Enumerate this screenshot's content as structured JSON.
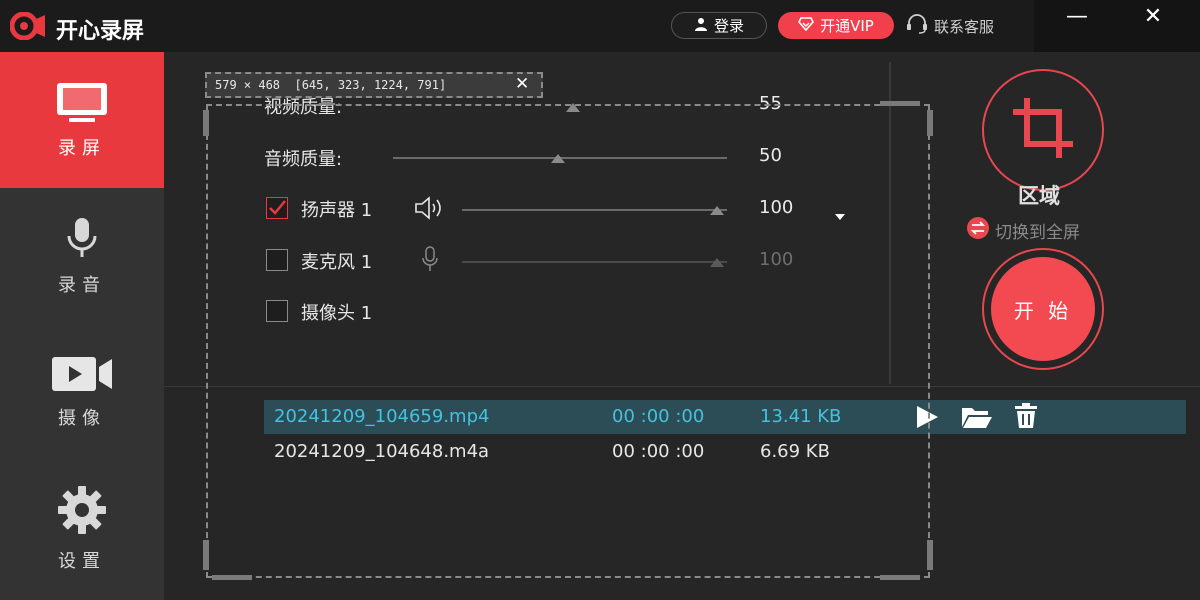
{
  "app": {
    "title": "开心录屏"
  },
  "header": {
    "login": "登录",
    "vip": "开通VIP",
    "service": "联系客服",
    "minimize": "—",
    "close": "✕"
  },
  "sidebar": {
    "items": [
      {
        "label": "录屏",
        "active": true
      },
      {
        "label": "录音",
        "active": false
      },
      {
        "label": "摄像",
        "active": false
      },
      {
        "label": "设置",
        "active": false
      }
    ]
  },
  "settings": {
    "video_quality": {
      "label": "视频质量:",
      "value": "55"
    },
    "audio_quality": {
      "label": "音频质量:",
      "value": "50"
    },
    "speaker": {
      "label": "扬声器 1",
      "value": "100",
      "checked": true
    },
    "mic": {
      "label": "麦克风 1",
      "value": "100",
      "checked": false
    },
    "camera": {
      "label": "摄像头 1",
      "checked": false
    }
  },
  "right_panel": {
    "region_label": "区域",
    "switch_label": "切换到全屏",
    "start_label": "开 始"
  },
  "files": [
    {
      "name": "20241209_104659.mp4",
      "duration": "00 :00 :00",
      "size": "13.41 KB",
      "selected": true
    },
    {
      "name": "20241209_104648.m4a",
      "duration": "00 :00 :00",
      "size": "6.69 KB",
      "selected": false
    }
  ],
  "selection": {
    "dimensions": "579 × 468  [645, 323, 1224, 791]",
    "close": "✕"
  },
  "colors": {
    "accent": "#e8393f",
    "selected_row": "#2c4d56",
    "selected_text": "#45c1e0"
  }
}
